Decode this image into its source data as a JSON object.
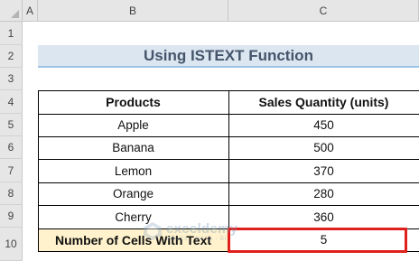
{
  "sheet": {
    "columns": [
      "A",
      "B",
      "C"
    ],
    "rows": [
      "1",
      "2",
      "3",
      "4",
      "5",
      "6",
      "7",
      "8",
      "9",
      "10"
    ]
  },
  "title": "Using ISTEXT Function",
  "table": {
    "headers": [
      "Products",
      "Sales Quantity (units)"
    ],
    "rows": [
      {
        "product": "Apple",
        "qty": "450"
      },
      {
        "product": "Banana",
        "qty": "500"
      },
      {
        "product": "Lemon",
        "qty": "370"
      },
      {
        "product": "Orange",
        "qty": "280"
      },
      {
        "product": "Cherry",
        "qty": "360"
      }
    ],
    "result_label": "Number of Cells With Text",
    "result_value": "5"
  },
  "watermark": {
    "name": "exceldemy",
    "tagline": "EXCEL · DATA · BI"
  },
  "colors": {
    "title_band": "#dce6f1",
    "result_fill": "#fff2cc",
    "highlight": "#e0201b"
  }
}
